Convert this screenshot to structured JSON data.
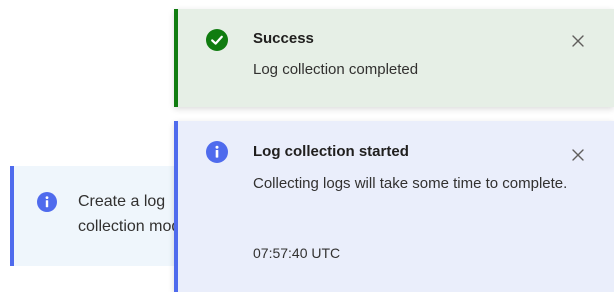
{
  "background_banner": {
    "icon": "info-icon",
    "text": "Create a log collection module.",
    "color": "#4f6bed"
  },
  "toasts": [
    {
      "type": "success",
      "icon": "check-circle-icon",
      "title": "Success",
      "message": "Log collection completed",
      "accent_color": "#107c10",
      "close_icon": "close-icon"
    },
    {
      "type": "info",
      "icon": "info-icon",
      "title": "Log collection started",
      "message": "Collecting logs will take some time to complete.",
      "timestamp": "07:57:40 UTC",
      "accent_color": "#4f6bed",
      "close_icon": "close-icon"
    }
  ]
}
